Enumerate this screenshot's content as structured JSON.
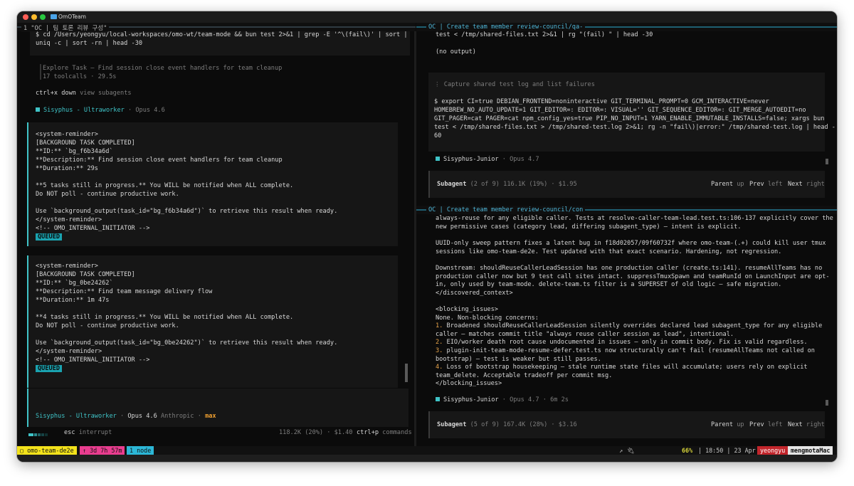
{
  "window": {
    "title": "OmOTeam"
  },
  "left_pane": {
    "header": "1 \"OC | 팀 토론 리뷰 구성\"",
    "command": [
      "$ cd /Users/yeongyu/local-workspaces/omo-wt/team-mode && bun test 2>&1 | grep -E '^\\(fail\\)' | sort |",
      "uniq -c | sort -rn | head -30"
    ],
    "explore_task": {
      "title": "Explore Task — Find session close event handlers for team cleanup",
      "meta": "17 toolcalls · 29.5s"
    },
    "subagent_hint": {
      "key": "ctrl+x down",
      "label": "view subagents"
    },
    "agent_line": {
      "name": "Sisyphus - Ultraworker",
      "model": "Opus 4.6"
    },
    "reminders": [
      {
        "lines": [
          "<system-reminder>",
          "[BACKGROUND TASK COMPLETED]",
          "**ID:** `bg_f6b34a6d`",
          "**Description:** Find session close event handlers for team cleanup",
          "**Duration:** 29s",
          "",
          "**5 tasks still in progress.** You WILL be notified when ALL complete.",
          "Do NOT poll - continue productive work.",
          "",
          "Use `background_output(task_id=\"bg_f6b34a6d\")` to retrieve this result when ready.",
          "</system-reminder>",
          "<!-- OMO_INTERNAL_INITIATOR -->"
        ],
        "badge": "QUEUED"
      },
      {
        "lines": [
          "<system-reminder>",
          "[BACKGROUND TASK COMPLETED]",
          "**ID:** `bg_0be24262`",
          "**Description:** Find team message delivery flow",
          "**Duration:** 1m 47s",
          "",
          "**4 tasks still in progress.** You WILL be notified when ALL complete.",
          "Do NOT poll - continue productive work.",
          "",
          "Use `background_output(task_id=\"bg_0be24262\")` to retrieve this result when ready.",
          "</system-reminder>",
          "<!-- OMO_INTERNAL_INITIATOR -->"
        ],
        "badge": "QUEUED"
      }
    ],
    "input_agent": {
      "name": "Sisyphus - Ultraworker",
      "model": "Opus 4.6",
      "provider": "Anthropic",
      "variant": "max"
    },
    "footer": {
      "esc_key": "esc",
      "esc_label": "interrupt",
      "tokens": "118.2K (20%) · $1.40",
      "cmd_key": "ctrl+p",
      "cmd_label": "commands"
    }
  },
  "right_top": {
    "header": "OC | Create team member review-council/qa-",
    "lines_top": [
      "test < /tmp/shared-files.txt 2>&1 | rg \"(fail) \" | head -30",
      "",
      "(no output)"
    ],
    "tool_title": "Capture shared test log and list failures",
    "tool_cmd": [
      "$ export CI=true DEBIAN_FRONTEND=noninteractive GIT_TERMINAL_PROMPT=0 GCM_INTERACTIVE=never",
      "HOMEBREW_NO_AUTO_UPDATE=1 GIT_EDITOR=: EDITOR=: VISUAL='' GIT_SEQUENCE_EDITOR=: GIT_MERGE_AUTOEDIT=no",
      "GIT_PAGER=cat PAGER=cat npm_config_yes=true PIP_NO_INPUT=1 YARN_ENABLE_IMMUTABLE_INSTALLS=false; xargs bun",
      "test < /tmp/shared-files.txt > /tmp/shared-test.log 2>&1; rg -n \"fail\\)|error:\" /tmp/shared-test.log | head -",
      "60"
    ],
    "agent": {
      "name": "Sisyphus-Junior",
      "model": "Opus 4.7"
    },
    "footer": {
      "label": "Subagent",
      "info": "(2 of 9) 116.1K (19%) · $1.95",
      "parent": "Parent",
      "parent_key": "up",
      "prev": "Prev",
      "prev_key": "left",
      "next": "Next",
      "next_key": "right"
    }
  },
  "right_bottom": {
    "header": "OC | Create team member review-council/con",
    "lines": [
      "always-reuse for any eligible caller. Tests at resolve-caller-team-lead.test.ts:106-137 explicitly cover the",
      "new permissive cases (category lead, differing subagent_type) — intent is explicit.",
      "",
      "UUID-only sweep pattern fixes a latent bug in f18d02057/09f60732f where omo-team-(.+) could kill user tmux",
      "sessions like omo-team-de2e. Test updated with that exact scenario. Hardening, not regression.",
      "",
      "Downstream: shouldReuseCallerLeadSession has one production caller (create.ts:141). resumeAllTeams has no",
      "production caller now but 9 test call sites intact. suppressTmuxSpawn and teamRunId on LaunchInput are opt-",
      "in, only used by team-mode. delete-team.ts filter is a SUPERSET of old logic — safe migration.",
      "</discovered_context>",
      "",
      "<blocking_issues>",
      "None. Non-blocking concerns:"
    ],
    "issues": [
      {
        "num": "1.",
        "lines": [
          "Broadened shouldReuseCallerLeadSession silently overrides declared lead subagent_type for any eligible",
          "caller — matches commit title \"always reuse caller session as lead\", intentional."
        ]
      },
      {
        "num": "2.",
        "lines": [
          "EIO/worker death root cause undocumented in issues — only in commit body. Fix is valid regardless."
        ]
      },
      {
        "num": "3.",
        "lines": [
          "plugin-init-team-mode-resume-defer.test.ts now structurally can't fail (resumeAllTeams not called on",
          "bootstrap) — test is weaker but still passes."
        ]
      },
      {
        "num": "4.",
        "lines": [
          "Loss of bootstrap housekeeping — stale runtime state files will accumulate; users rely on explicit",
          "team_delete. Acceptable tradeoff per commit msg."
        ]
      }
    ],
    "closing": "</blocking_issues>",
    "agent": {
      "name": "Sisyphus-Junior",
      "model": "Opus 4.7",
      "duration": "6m 2s"
    },
    "footer": {
      "label": "Subagent",
      "info": "(5 of 9) 167.4K (28%) · $3.16",
      "parent": "Parent",
      "parent_key": "up",
      "prev": "Prev",
      "prev_key": "left",
      "next": "Next",
      "next_key": "right"
    }
  },
  "statusbar": {
    "session": "omo-team-de2e",
    "uptime": "3d 7h 57m",
    "nodes": "1 node",
    "arrow": "↗",
    "battery_pct": "66%",
    "battery_level": 0.66,
    "time": "18:50",
    "date": "23 Apr",
    "user": "yeongyu",
    "host": "mengmotaMac"
  },
  "colors": {
    "accent_teal": "#3fc3c7",
    "badge": "#1aa3b0",
    "status_yellow": "#f3e21b",
    "status_magenta": "#e93d8f",
    "status_cyan": "#2cb7d7",
    "status_red": "#c2252b",
    "max_orange": "#f0a030"
  }
}
